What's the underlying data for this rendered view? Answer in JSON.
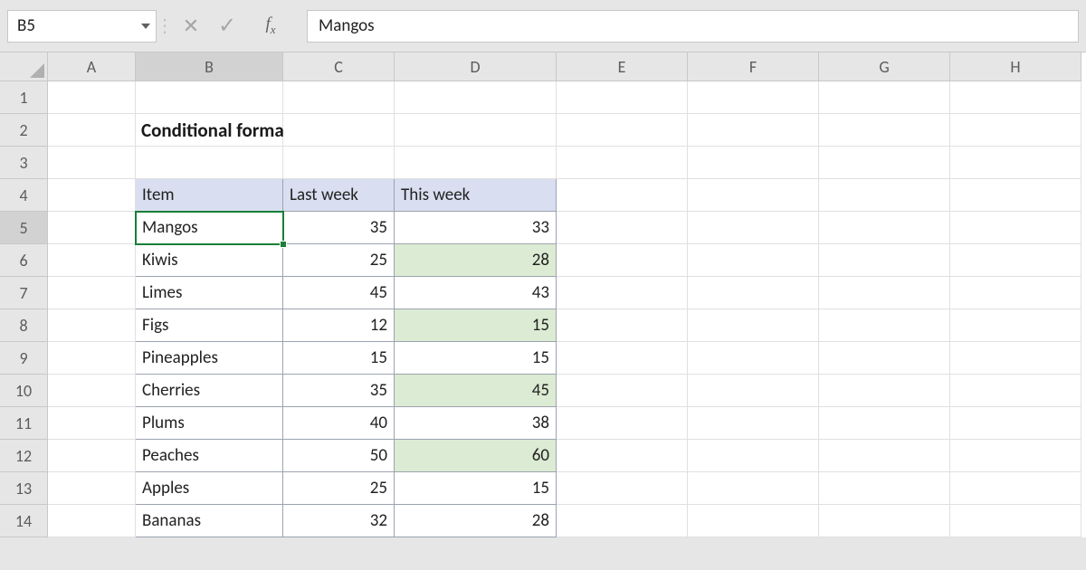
{
  "name_box": "B5",
  "formula_value": "Mangos",
  "columns": [
    "A",
    "B",
    "C",
    "D",
    "E",
    "F",
    "G",
    "H"
  ],
  "row_count": 14,
  "selected": {
    "col": "B",
    "row": 5
  },
  "title": "Conditional formatting based on another column",
  "table": {
    "headers": [
      "Item",
      "Last week",
      "This week"
    ],
    "rows": [
      {
        "item": "Mangos",
        "last": 35,
        "this": 33,
        "hl": false
      },
      {
        "item": "Kiwis",
        "last": 25,
        "this": 28,
        "hl": true
      },
      {
        "item": "Limes",
        "last": 45,
        "this": 43,
        "hl": false
      },
      {
        "item": "Figs",
        "last": 12,
        "this": 15,
        "hl": true
      },
      {
        "item": "Pineapples",
        "last": 15,
        "this": 15,
        "hl": false
      },
      {
        "item": "Cherries",
        "last": 35,
        "this": 45,
        "hl": true
      },
      {
        "item": "Plums",
        "last": 40,
        "this": 38,
        "hl": false
      },
      {
        "item": "Peaches",
        "last": 50,
        "this": 60,
        "hl": true
      },
      {
        "item": "Apples",
        "last": 25,
        "this": 15,
        "hl": false
      },
      {
        "item": "Bananas",
        "last": 32,
        "this": 28,
        "hl": false
      }
    ]
  }
}
